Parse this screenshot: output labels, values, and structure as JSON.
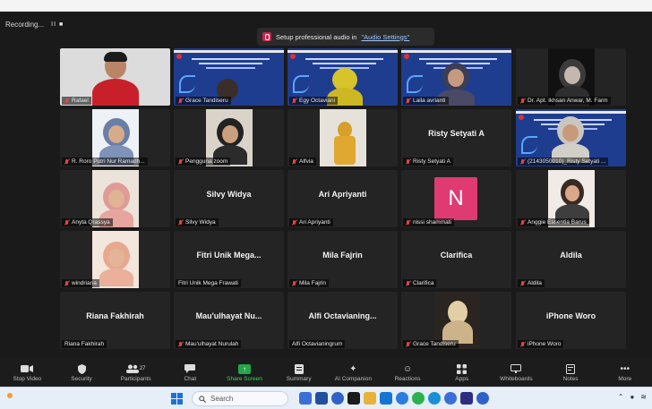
{
  "recording": {
    "label": "Recording...",
    "controls": "II ■"
  },
  "banner": {
    "prefix": "Setup professional audio in ",
    "link": "\"Audio Settings\""
  },
  "tiles": [
    {
      "name": "Rafael",
      "big": ""
    },
    {
      "name": "Grace Tandiseru",
      "big": ""
    },
    {
      "name": "Egy Octaviani",
      "big": ""
    },
    {
      "name": "Laila avrianti",
      "big": ""
    },
    {
      "name": "Dr. Apt. Ikhsan Anwar, M. Farm",
      "big": ""
    },
    {
      "name": "R. Roro Putri Nur Ramadh...",
      "big": ""
    },
    {
      "name": "Pengguna zoom",
      "big": ""
    },
    {
      "name": "Alfvia",
      "big": ""
    },
    {
      "name": "Risty Setyati A",
      "big": "Risty Setyati A"
    },
    {
      "name": "(2143050010)_Risty Setyati ...",
      "big": ""
    },
    {
      "name": "Anyta Qrassya",
      "big": ""
    },
    {
      "name": "Silvy Widya",
      "big": "Silvy Widya"
    },
    {
      "name": "Ari Apriyanti",
      "big": "Ari Apriyanti"
    },
    {
      "name": "nissi shammati",
      "big": ""
    },
    {
      "name": "Anggie Essentia Barus",
      "big": ""
    },
    {
      "name": "windriana",
      "big": ""
    },
    {
      "name": "Fitri Unik Mega Frawati",
      "big": "Fitri Unik Mega..."
    },
    {
      "name": "Mila Fajrin",
      "big": "Mila Fajrin"
    },
    {
      "name": "Clarifica",
      "big": "Clarifica"
    },
    {
      "name": "Aldila",
      "big": "Aldila"
    },
    {
      "name": "Riana Fakhirah",
      "big": "Riana Fakhirah"
    },
    {
      "name": "Mau'ulhayat Nurulah",
      "big": "Mau'ulhayat Nu..."
    },
    {
      "name": "Alfi Octavianingrum",
      "big": "Alfi Octavianing..."
    },
    {
      "name": "Grace Tandiseru",
      "big": ""
    },
    {
      "name": "iPhone Woro",
      "big": "iPhone Woro"
    }
  ],
  "avatar_letter": "N",
  "toolbar": {
    "stop_video": "Stop Video",
    "security": "Security",
    "participants": "Participants",
    "participants_count": "27",
    "chat": "Chat",
    "share_screen": "Share Screen",
    "summary": "Summary",
    "ai_companion": "AI Companion",
    "reactions": "Reactions",
    "apps": "Apps",
    "whiteboards": "Whiteboards",
    "notes": "Notes",
    "more": "More"
  },
  "taskbar": {
    "search_placeholder": "Search"
  },
  "colors": {
    "active_speaker": "#d8e23e",
    "share_green": "#24a64a",
    "avatar_pink": "#e03a72",
    "slide_blue": "#1f3d8f"
  }
}
